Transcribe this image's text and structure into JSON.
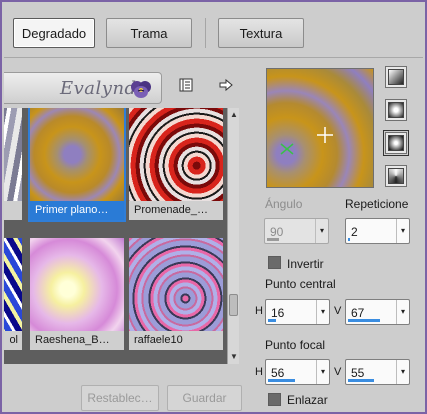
{
  "tabs": [
    {
      "label": "Degradado",
      "active": true
    },
    {
      "label": "Trama",
      "active": false
    },
    {
      "label": "Textura",
      "active": false
    }
  ],
  "banner": {
    "text": "Evalynda"
  },
  "toolbar": {
    "icons": [
      "book-icon",
      "arrow-right-icon"
    ]
  },
  "gradients": [
    {
      "caption": "",
      "selected": false
    },
    {
      "caption": "Primer plano…",
      "selected": true
    },
    {
      "caption": "Promenade_…",
      "selected": false
    },
    {
      "caption": "ol",
      "selected": false
    },
    {
      "caption": "Raeshena_B…",
      "selected": false
    },
    {
      "caption": "raffaele10",
      "selected": false
    }
  ],
  "buttons": {
    "reset": "Restablec…",
    "save": "Guardar"
  },
  "angle": {
    "label": "Ángulo",
    "value": "90",
    "fill_fraction": 0.25
  },
  "repeats": {
    "label": "Repeticione",
    "value": "2",
    "fill_fraction": 0.02
  },
  "invert": {
    "label": "Invertir",
    "checked": false
  },
  "center": {
    "label": "Punto central",
    "h_label": "H",
    "h_value": "16",
    "v_label": "V",
    "v_value": "67"
  },
  "focal": {
    "label": "Punto focal",
    "h_label": "H",
    "h_value": "56",
    "v_label": "V",
    "v_value": "55"
  },
  "link": {
    "label": "Enlazar",
    "checked": false
  },
  "colors": {
    "accent": "#2a7bd6",
    "frame": "#7b63a6",
    "gold": "#c8941a",
    "purple": "#8f7fc0"
  }
}
